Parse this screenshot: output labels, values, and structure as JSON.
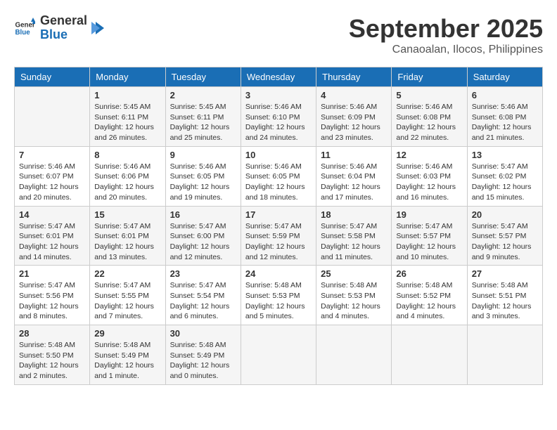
{
  "header": {
    "logo_line1": "General",
    "logo_line2": "Blue",
    "month_title": "September 2025",
    "location": "Canaoalan, Ilocos, Philippines"
  },
  "days_of_week": [
    "Sunday",
    "Monday",
    "Tuesday",
    "Wednesday",
    "Thursday",
    "Friday",
    "Saturday"
  ],
  "weeks": [
    [
      {
        "day": "",
        "info": ""
      },
      {
        "day": "1",
        "info": "Sunrise: 5:45 AM\nSunset: 6:11 PM\nDaylight: 12 hours\nand 26 minutes."
      },
      {
        "day": "2",
        "info": "Sunrise: 5:45 AM\nSunset: 6:11 PM\nDaylight: 12 hours\nand 25 minutes."
      },
      {
        "day": "3",
        "info": "Sunrise: 5:46 AM\nSunset: 6:10 PM\nDaylight: 12 hours\nand 24 minutes."
      },
      {
        "day": "4",
        "info": "Sunrise: 5:46 AM\nSunset: 6:09 PM\nDaylight: 12 hours\nand 23 minutes."
      },
      {
        "day": "5",
        "info": "Sunrise: 5:46 AM\nSunset: 6:08 PM\nDaylight: 12 hours\nand 22 minutes."
      },
      {
        "day": "6",
        "info": "Sunrise: 5:46 AM\nSunset: 6:08 PM\nDaylight: 12 hours\nand 21 minutes."
      }
    ],
    [
      {
        "day": "7",
        "info": "Sunrise: 5:46 AM\nSunset: 6:07 PM\nDaylight: 12 hours\nand 20 minutes."
      },
      {
        "day": "8",
        "info": "Sunrise: 5:46 AM\nSunset: 6:06 PM\nDaylight: 12 hours\nand 20 minutes."
      },
      {
        "day": "9",
        "info": "Sunrise: 5:46 AM\nSunset: 6:05 PM\nDaylight: 12 hours\nand 19 minutes."
      },
      {
        "day": "10",
        "info": "Sunrise: 5:46 AM\nSunset: 6:05 PM\nDaylight: 12 hours\nand 18 minutes."
      },
      {
        "day": "11",
        "info": "Sunrise: 5:46 AM\nSunset: 6:04 PM\nDaylight: 12 hours\nand 17 minutes."
      },
      {
        "day": "12",
        "info": "Sunrise: 5:46 AM\nSunset: 6:03 PM\nDaylight: 12 hours\nand 16 minutes."
      },
      {
        "day": "13",
        "info": "Sunrise: 5:47 AM\nSunset: 6:02 PM\nDaylight: 12 hours\nand 15 minutes."
      }
    ],
    [
      {
        "day": "14",
        "info": "Sunrise: 5:47 AM\nSunset: 6:01 PM\nDaylight: 12 hours\nand 14 minutes."
      },
      {
        "day": "15",
        "info": "Sunrise: 5:47 AM\nSunset: 6:01 PM\nDaylight: 12 hours\nand 13 minutes."
      },
      {
        "day": "16",
        "info": "Sunrise: 5:47 AM\nSunset: 6:00 PM\nDaylight: 12 hours\nand 12 minutes."
      },
      {
        "day": "17",
        "info": "Sunrise: 5:47 AM\nSunset: 5:59 PM\nDaylight: 12 hours\nand 12 minutes."
      },
      {
        "day": "18",
        "info": "Sunrise: 5:47 AM\nSunset: 5:58 PM\nDaylight: 12 hours\nand 11 minutes."
      },
      {
        "day": "19",
        "info": "Sunrise: 5:47 AM\nSunset: 5:57 PM\nDaylight: 12 hours\nand 10 minutes."
      },
      {
        "day": "20",
        "info": "Sunrise: 5:47 AM\nSunset: 5:57 PM\nDaylight: 12 hours\nand 9 minutes."
      }
    ],
    [
      {
        "day": "21",
        "info": "Sunrise: 5:47 AM\nSunset: 5:56 PM\nDaylight: 12 hours\nand 8 minutes."
      },
      {
        "day": "22",
        "info": "Sunrise: 5:47 AM\nSunset: 5:55 PM\nDaylight: 12 hours\nand 7 minutes."
      },
      {
        "day": "23",
        "info": "Sunrise: 5:47 AM\nSunset: 5:54 PM\nDaylight: 12 hours\nand 6 minutes."
      },
      {
        "day": "24",
        "info": "Sunrise: 5:48 AM\nSunset: 5:53 PM\nDaylight: 12 hours\nand 5 minutes."
      },
      {
        "day": "25",
        "info": "Sunrise: 5:48 AM\nSunset: 5:53 PM\nDaylight: 12 hours\nand 4 minutes."
      },
      {
        "day": "26",
        "info": "Sunrise: 5:48 AM\nSunset: 5:52 PM\nDaylight: 12 hours\nand 4 minutes."
      },
      {
        "day": "27",
        "info": "Sunrise: 5:48 AM\nSunset: 5:51 PM\nDaylight: 12 hours\nand 3 minutes."
      }
    ],
    [
      {
        "day": "28",
        "info": "Sunrise: 5:48 AM\nSunset: 5:50 PM\nDaylight: 12 hours\nand 2 minutes."
      },
      {
        "day": "29",
        "info": "Sunrise: 5:48 AM\nSunset: 5:49 PM\nDaylight: 12 hours\nand 1 minute."
      },
      {
        "day": "30",
        "info": "Sunrise: 5:48 AM\nSunset: 5:49 PM\nDaylight: 12 hours\nand 0 minutes."
      },
      {
        "day": "",
        "info": ""
      },
      {
        "day": "",
        "info": ""
      },
      {
        "day": "",
        "info": ""
      },
      {
        "day": "",
        "info": ""
      }
    ]
  ]
}
